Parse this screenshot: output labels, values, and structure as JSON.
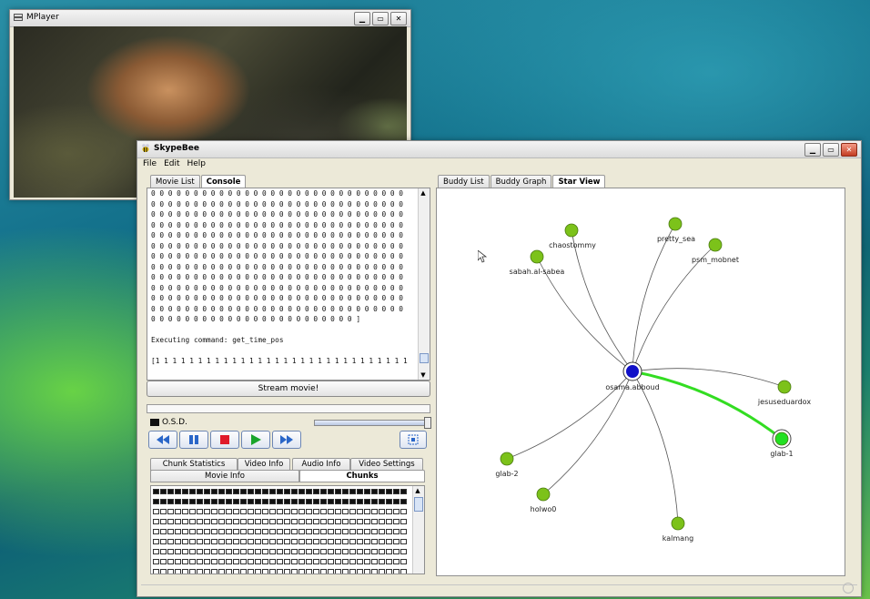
{
  "mplayer": {
    "title": "MPlayer",
    "buttons": [
      "minimize",
      "maximize",
      "close"
    ]
  },
  "skypebee": {
    "title": "SkypeBee",
    "menu": [
      "File",
      "Edit",
      "Help"
    ],
    "left_tabs": [
      "Movie List",
      "Console"
    ],
    "console_lines": [
      "0 0 0 0 0 0 0 0 0 0 0 0 0 0 0 0 0 0 0 0 0 0 0 0 0 0 0 0 0 0",
      "0 0 0 0 0 0 0 0 0 0 0 0 0 0 0 0 0 0 0 0 0 0 0 0 0 0 0 0 0 0",
      "0 0 0 0 0 0 0 0 0 0 0 0 0 0 0 0 0 0 0 0 0 0 0 0 0 0 0 0 0 0",
      "0 0 0 0 0 0 0 0 0 0 0 0 0 0 0 0 0 0 0 0 0 0 0 0 0 0 0 0 0 0",
      "0 0 0 0 0 0 0 0 0 0 0 0 0 0 0 0 0 0 0 0 0 0 0 0 0 0 0 0 0 0",
      "0 0 0 0 0 0 0 0 0 0 0 0 0 0 0 0 0 0 0 0 0 0 0 0 0 0 0 0 0 0",
      "0 0 0 0 0 0 0 0 0 0 0 0 0 0 0 0 0 0 0 0 0 0 0 0 0 0 0 0 0 0",
      "0 0 0 0 0 0 0 0 0 0 0 0 0 0 0 0 0 0 0 0 0 0 0 0 0 0 0 0 0 0",
      "0 0 0 0 0 0 0 0 0 0 0 0 0 0 0 0 0 0 0 0 0 0 0 0 0 0 0 0 0 0",
      "0 0 0 0 0 0 0 0 0 0 0 0 0 0 0 0 0 0 0 0 0 0 0 0 0 0 0 0 0 0",
      "0 0 0 0 0 0 0 0 0 0 0 0 0 0 0 0 0 0 0 0 0 0 0 0 0 0 0 0 0 0",
      "0 0 0 0 0 0 0 0 0 0 0 0 0 0 0 0 0 0 0 0 0 0 0 0 0 0 0 0 0 0",
      "0 0 0 0 0 0 0 0 0 0 0 0 0 0 0 0 0 0 0 0 0 0 0 0 ]",
      "",
      "Executing command: get_time_pos",
      "",
      "[1 1 1 1 1 1 1 1 1 1 1 1 1 1 1 1 1 1 1 1 1 1 1 1 1 1 1 1 1 1"
    ],
    "stream_button": "Stream movie!",
    "osd_label": "O.S.D.",
    "controls": [
      "rewind",
      "pause",
      "stop",
      "play",
      "fast-forward"
    ],
    "info_tabs_top": [
      "Chunk Statistics",
      "Video Info",
      "Audio Info",
      "Video Settings"
    ],
    "info_tabs_bottom": [
      "Movie Info",
      "Chunks"
    ],
    "chunks": {
      "rows": 9,
      "cols": 40,
      "filled_rows": [
        0,
        1
      ]
    },
    "right_tabs": [
      "Buddy List",
      "Buddy Graph",
      "Star View"
    ],
    "graph": {
      "center": {
        "label": "osama.abboud",
        "color": "#1010c8"
      },
      "nodes": [
        {
          "label": "chaostommy",
          "color": "#7cc21a"
        },
        {
          "label": "pretty_sea",
          "color": "#7cc21a"
        },
        {
          "label": "sabah.al-sabea",
          "color": "#7cc21a"
        },
        {
          "label": "psm_mobnet",
          "color": "#7cc21a"
        },
        {
          "label": "jesuseduardox",
          "color": "#7cc21a"
        },
        {
          "label": "glab-1",
          "color": "#22e022",
          "highlight": true
        },
        {
          "label": "glab-2",
          "color": "#7cc21a"
        },
        {
          "label": "holwo0",
          "color": "#7cc21a"
        },
        {
          "label": "kalmang",
          "color": "#7cc21a",
          "label_color": "#1a1a9a"
        }
      ],
      "highlight_edge_color": "#33dd22"
    }
  }
}
